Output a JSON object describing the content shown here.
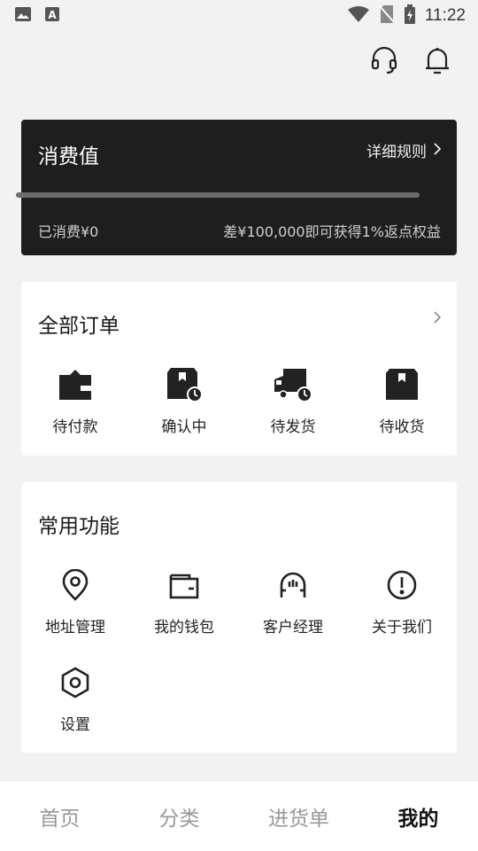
{
  "status_bar": {
    "time": "11:22",
    "icons": [
      "image-icon",
      "a-icon",
      "wifi-icon",
      "no-sim-icon",
      "battery-charging-icon"
    ]
  },
  "top_actions": {
    "icons": [
      "headset-icon",
      "bell-icon"
    ]
  },
  "spend": {
    "title": "消费值",
    "rules_label": "详细规则",
    "spent_text": "已消费¥0",
    "remaining_text": "差¥100,000即可获得1%返点权益",
    "progress_fraction": 0
  },
  "orders": {
    "title": "全部订单",
    "items": [
      {
        "label": "待付款",
        "icon": "wallet-icon"
      },
      {
        "label": "确认中",
        "icon": "box-clock-icon"
      },
      {
        "label": "待发货",
        "icon": "truck-clock-icon"
      },
      {
        "label": "待收货",
        "icon": "box-icon"
      }
    ]
  },
  "functions": {
    "title": "常用功能",
    "items": [
      {
        "label": "地址管理",
        "icon": "location-pin-icon"
      },
      {
        "label": "我的钱包",
        "icon": "wallet-outline-icon"
      },
      {
        "label": "客户经理",
        "icon": "headset-outline-icon"
      },
      {
        "label": "关于我们",
        "icon": "info-circle-icon"
      },
      {
        "label": "设置",
        "icon": "hexagon-settings-icon"
      }
    ]
  },
  "bottom_nav": {
    "items": [
      {
        "label": "首页",
        "active": false
      },
      {
        "label": "分类",
        "active": false
      },
      {
        "label": "进货单",
        "active": false
      },
      {
        "label": "我的",
        "active": true
      }
    ]
  },
  "colors": {
    "card_dark": "#1e1e1e",
    "page_bg": "#f2f2f2",
    "nav_inactive": "#999999",
    "nav_active": "#111111"
  }
}
